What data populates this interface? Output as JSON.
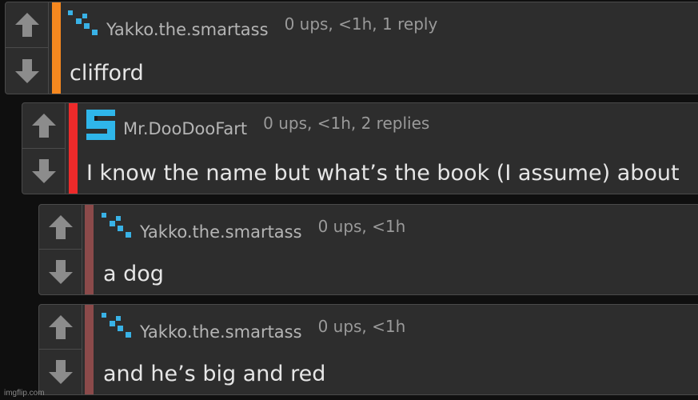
{
  "comments": [
    {
      "username": "Yakko.the.smartass",
      "meta": "0 ups, <1h, 1 reply",
      "body": "clifford",
      "avatar": "pixel-dots-avatar",
      "stripe_color": "#f6881f"
    },
    {
      "username": "Mr.DooDooFart",
      "meta": "0 ups, <1h, 2 replies",
      "body": "I know the name but what’s the book (I assume) about",
      "avatar": "pixel-s-avatar",
      "stripe_color": "#ee2a2a"
    },
    {
      "username": "Yakko.the.smartass",
      "meta": "0 ups, <1h",
      "body": "a dog",
      "avatar": "pixel-dots-avatar",
      "stripe_color": "#8b4a4a"
    },
    {
      "username": "Yakko.the.smartass",
      "meta": "0 ups, <1h",
      "body": "and he’s big and red",
      "avatar": "pixel-dots-avatar",
      "stripe_color": "#8b4a4a"
    }
  ],
  "icons": {
    "upvote": "arrow-up-icon",
    "downvote": "arrow-down-icon"
  },
  "watermark": "imgflip.com"
}
